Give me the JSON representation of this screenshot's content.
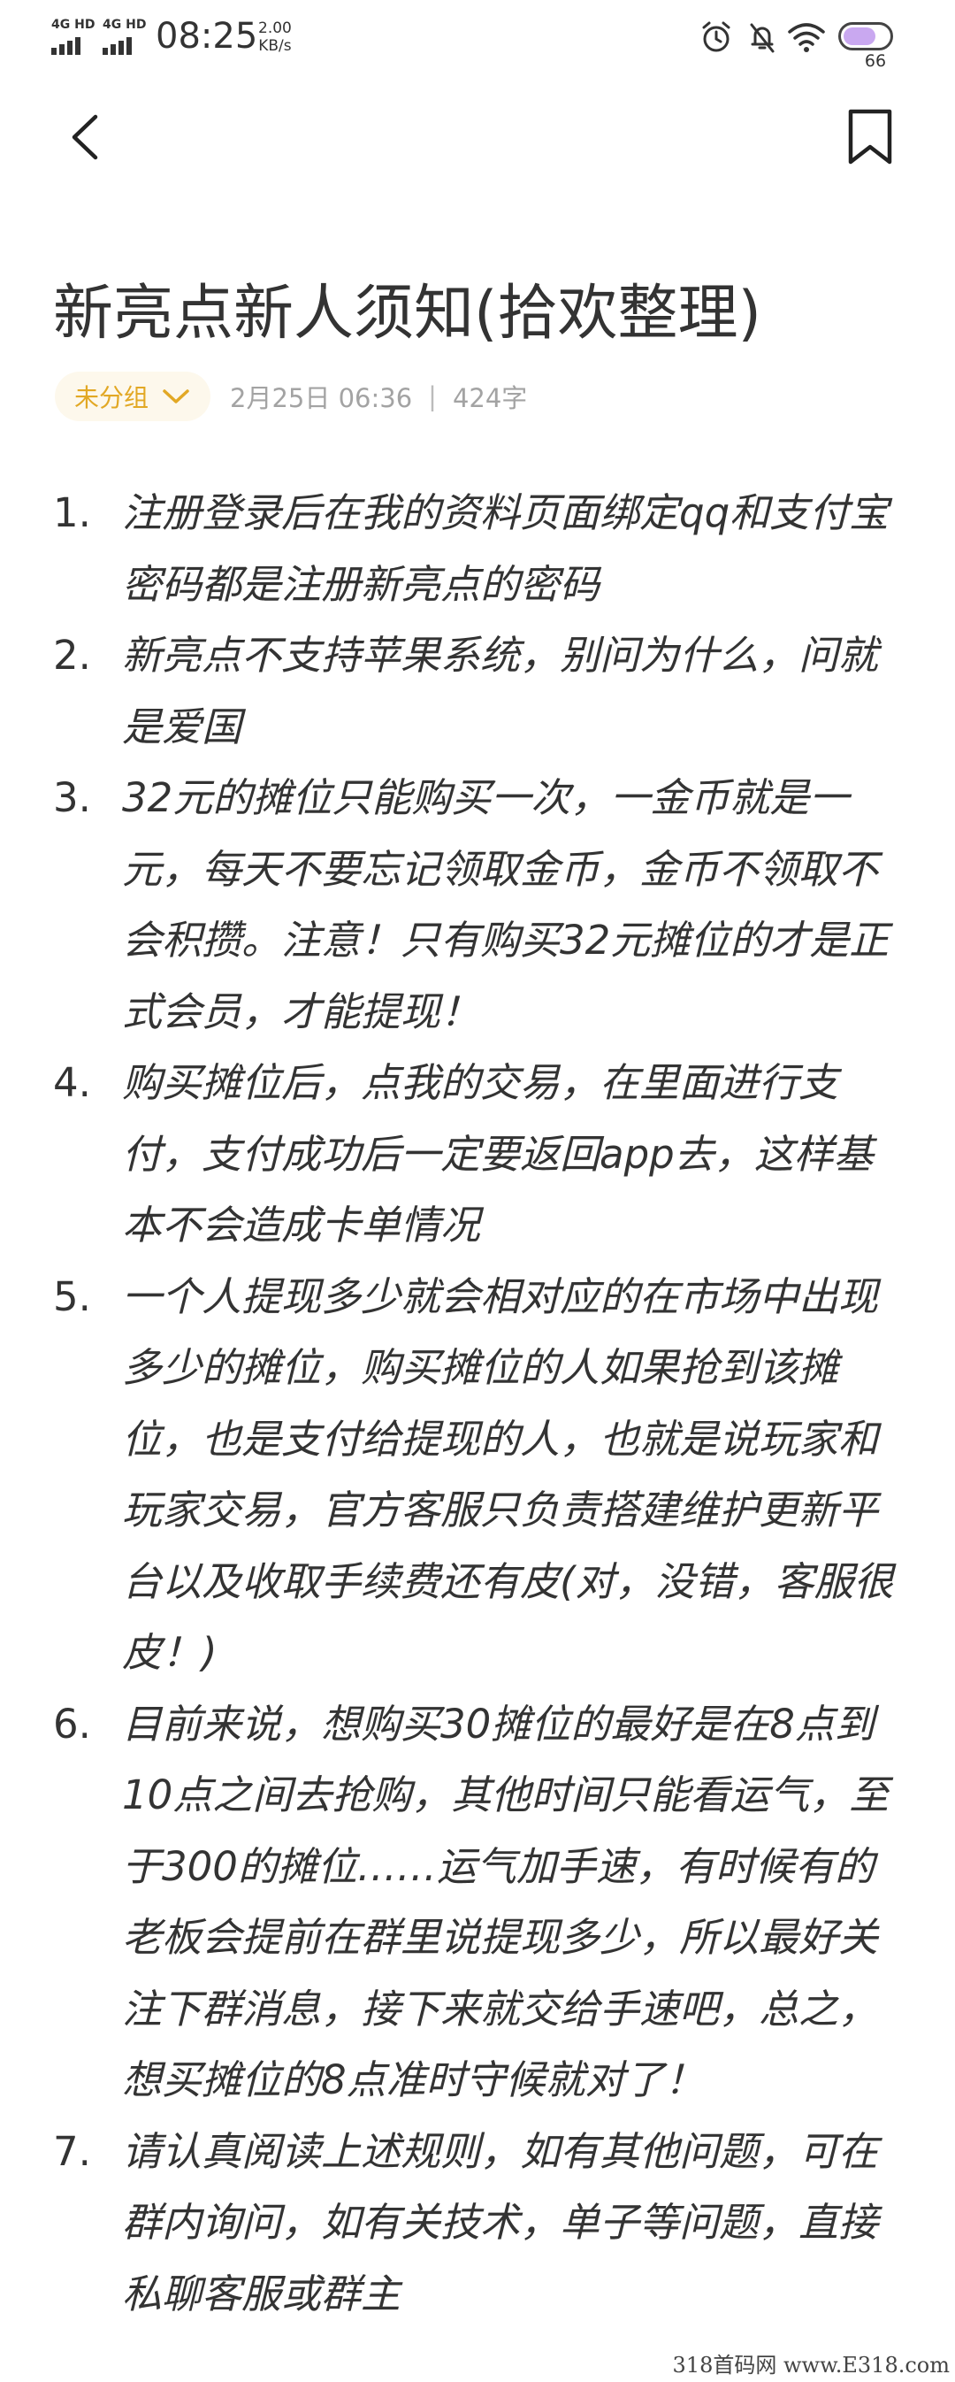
{
  "status_bar": {
    "signal_1": "4G HD",
    "signal_2": "4G HD",
    "time": "08:25",
    "speed_value": "2.00",
    "speed_unit": "KB/s",
    "battery": "66",
    "icons": [
      "alarm-icon",
      "mute-notification-icon",
      "wifi-icon",
      "battery-icon"
    ]
  },
  "header": {
    "back_icon": "chevron-left-icon",
    "bookmark_icon": "bookmark-icon"
  },
  "note": {
    "title": "新亮点新人须知(拾欢整理)",
    "group_label": "未分组",
    "date": "2月25日 06:36",
    "separator": "|",
    "word_count": "424字",
    "items": [
      {
        "num": "1.",
        "text": "注册登录后在我的资料页面绑定qq和支付宝密码都是注册新亮点的密码"
      },
      {
        "num": "2.",
        "text": "新亮点不支持苹果系统，别问为什么，问就是爱国"
      },
      {
        "num": "3.",
        "text": "32元的摊位只能购买一次，一金币就是一元，每天不要忘记领取金币，金币不领取不会积攒。注意！只有购买32元摊位的才是正式会员，才能提现！"
      },
      {
        "num": "4.",
        "text": "购买摊位后，点我的交易，在里面进行支付，支付成功后一定要返回app去，这样基本不会造成卡单情况"
      },
      {
        "num": "5.",
        "text": "一个人提现多少就会相对应的在市场中出现多少的摊位，购买摊位的人如果抢到该摊位，也是支付给提现的人，也就是说玩家和玩家交易，官方客服只负责搭建维护更新平台以及收取手续费还有皮(对，没错，客服很皮！)"
      },
      {
        "num": "6.",
        "text": "目前来说，想购买30摊位的最好是在8点到10点之间去抢购，其他时间只能看运气，至于300的摊位……运气加手速，有时候有的老板会提前在群里说提现多少，所以最好关注下群消息，接下来就交给手速吧，总之，想买摊位的8点准时守候就对了！"
      },
      {
        "num": "7.",
        "text": "请认真阅读上述规则，如有其他问题，可在群内询问，如有关技术，单子等问题，直接私聊客服或群主"
      }
    ]
  },
  "watermark": "318首码网 www.E318.com"
}
